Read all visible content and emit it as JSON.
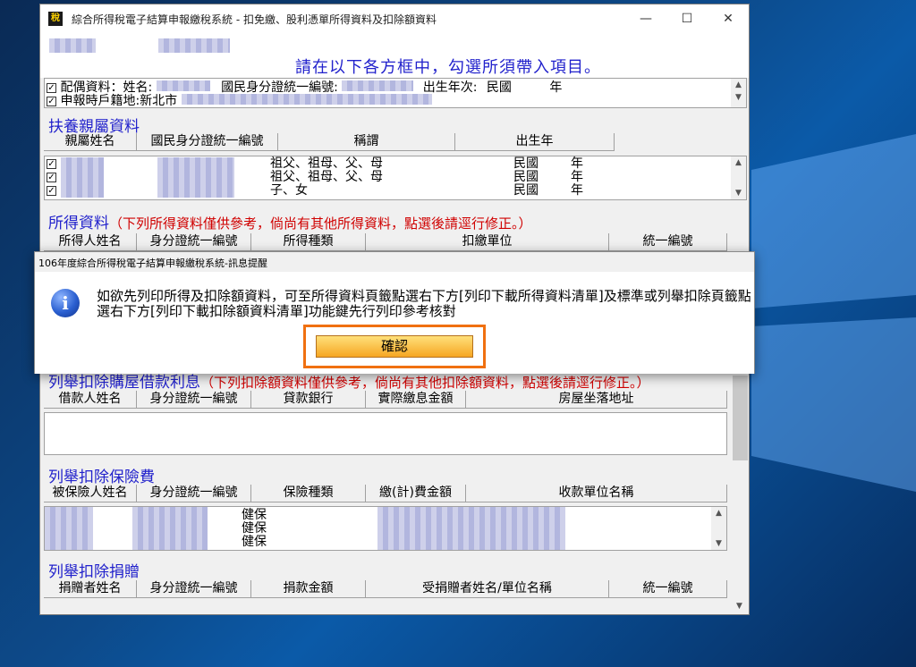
{
  "window": {
    "title": "綜合所得稅電子結算申報繳稅系統 - 扣免繳、股利憑單所得資料及扣除額資料",
    "icon": "app-icon",
    "controls": [
      "minimize-icon",
      "maximize-icon",
      "close-icon"
    ]
  },
  "top": {
    "headline": "請在以下各方框中，勾選所須帶入項目。",
    "filer_line": "配偶資料：姓名:",
    "filer_id_label": "國民身分證統一編號:",
    "birth_label": "出生年次:",
    "birth_value": "民國",
    "birth_unit": "年",
    "address_line": "申報時戶籍地:新北市"
  },
  "dependents": {
    "title": "扶養親屬資料",
    "columns": [
      "親屬姓名",
      "國民身分證統一編號",
      "稱謂",
      "出生年"
    ],
    "rows": [
      {
        "relation": "祖父、祖母、父、母",
        "roc": "民國",
        "unit": "年",
        "checked": true
      },
      {
        "relation": "祖父、祖母、父、母",
        "roc": "民國",
        "unit": "年",
        "checked": true
      },
      {
        "relation": "子、女",
        "roc": "民國",
        "unit": "年",
        "checked": true
      }
    ]
  },
  "income": {
    "title": "所得資料",
    "note": "（下列所得資料僅供參考，倘尚有其他所得資料，點選後請逕行修正。）",
    "columns": [
      "所得人姓名",
      "身分證統一編號",
      "所得種類",
      "扣繳單位",
      "統一編號"
    ]
  },
  "mortgage": {
    "title": "列舉扣除購屋借款利息",
    "note": "（下列扣除額資料僅供參考，倘尚有其他扣除額資料，點選後請逕行修正。）",
    "columns": [
      "借款人姓名",
      "身分證統一編號",
      "貸款銀行",
      "實際繳息金額",
      "房屋坐落地址"
    ]
  },
  "insurance": {
    "title": "列舉扣除保險費",
    "columns": [
      "被保險人姓名",
      "身分證統一編號",
      "保險種類",
      "繳(計)費金額",
      "收款單位名稱"
    ],
    "rows": [
      "健保",
      "健保",
      "健保"
    ]
  },
  "donation": {
    "title": "列舉扣除捐贈",
    "columns": [
      "捐贈者姓名",
      "身分證統一編號",
      "捐款金額",
      "受捐贈者姓名/單位名稱",
      "統一編號"
    ]
  },
  "dialog": {
    "title": "106年度綜合所得稅電子結算申報繳稅系統-訊息提醒",
    "icon": "info-icon",
    "message": "如欲先列印所得及扣除額資料，可至所得資料頁籤點選右下方[列印下載所得資料清單]及標準或列舉扣除頁籤點選右下方[列印下載扣除額資料清單]功能鍵先行列印參考核對",
    "confirm": "確認"
  },
  "colors": {
    "accent_blue": "#2222cc",
    "note_red": "#d00000",
    "button_orange": "#f6a623",
    "highlight": "#f07010"
  }
}
